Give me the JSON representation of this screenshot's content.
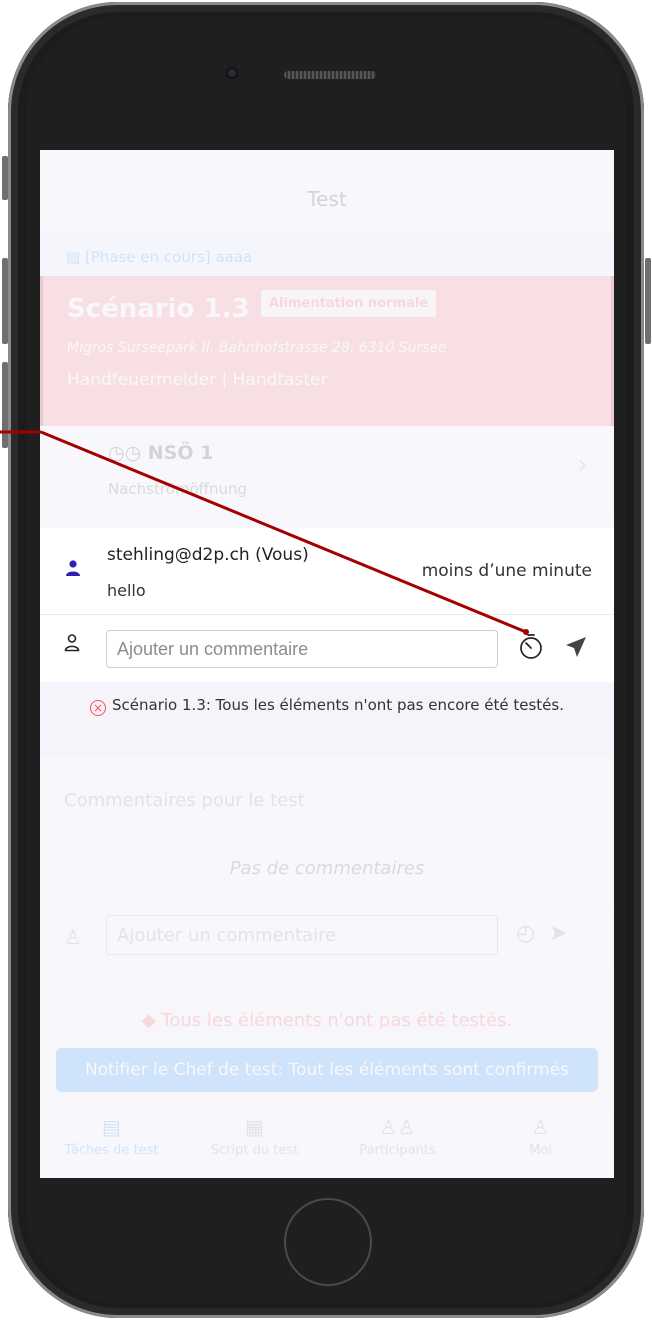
{
  "header": {
    "title": "Test"
  },
  "phase_banner": {
    "label": "[Phase en cours] aaaa"
  },
  "scenario": {
    "title": "Scénario 1.3",
    "tag": "Alimentation normale",
    "address": "Migros Surseepark II, Bahnhofstrasse 28, 6310 Sursee",
    "devices": "Handfeuermelder | Handtaster"
  },
  "nso": {
    "name": "NSÖ 1",
    "subtitle": "Nachströmöffnung"
  },
  "comment_panel": {
    "comments": [
      {
        "author": "stehling@d2p.ch (Vous)",
        "text": "hello",
        "time": "moins d’une minute"
      }
    ],
    "input": {
      "placeholder": "Ajouter un commentaire",
      "value": ""
    },
    "warning": "Scénario 1.3: Tous les éléments n'ont pas encore été testés."
  },
  "test_comments": {
    "title": "Commentaires pour le test",
    "empty": "Pas de commentaires",
    "input_placeholder": "Ajouter un commentaire"
  },
  "footer_warning": "Tous les éléments n'ont pas été testés.",
  "notify_button": "Notifier le Chef de test: Tout les éléments sont confirmés",
  "tabs": [
    {
      "label": "Tâches de test",
      "icon": "tasks-icon"
    },
    {
      "label": "Script du test",
      "icon": "calendar-icon"
    },
    {
      "label": "Participants",
      "icon": "people-icon"
    },
    {
      "label": "Moi",
      "icon": "user-icon"
    }
  ],
  "colors": {
    "accent": "#1890ff",
    "danger": "#ff4d4f",
    "scenario_bg": "#ff7875",
    "annotation": "#a30000"
  }
}
